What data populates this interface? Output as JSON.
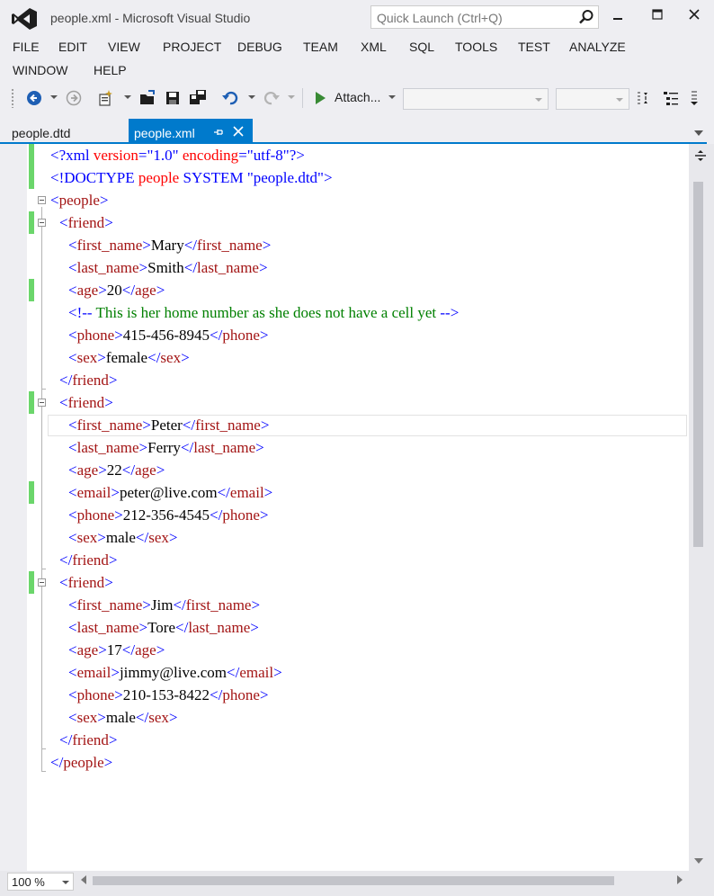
{
  "window": {
    "title": "people.xml - Microsoft Visual Studio",
    "quick_launch_placeholder": "Quick Launch (Ctrl+Q)"
  },
  "menu": [
    {
      "label": "FILE"
    },
    {
      "label": "EDIT"
    },
    {
      "label": "VIEW"
    },
    {
      "label": "PROJECT"
    },
    {
      "label": "DEBUG"
    },
    {
      "label": "TEAM"
    },
    {
      "label": "XML"
    },
    {
      "label": "SQL"
    },
    {
      "label": "TOOLS"
    },
    {
      "label": "TEST"
    },
    {
      "label": "ANALYZE"
    },
    {
      "label": "WINDOW"
    },
    {
      "label": "HELP"
    }
  ],
  "toolbar": {
    "attach_label": "Attach...",
    "icons": [
      "back-icon",
      "forward-icon",
      "new-project-icon",
      "open-file-icon",
      "save-icon",
      "save-all-icon",
      "undo-icon",
      "redo-icon",
      "start-icon"
    ]
  },
  "tabs": {
    "inactive": "people.dtd",
    "active": "people.xml"
  },
  "editor": {
    "lines": [
      [
        "<?xml ",
        "version",
        "=\"1.0\" ",
        "encoding",
        "=\"utf-8\"?>"
      ],
      [
        "<!DOCTYPE ",
        "people",
        " SYSTEM ",
        "\"people.dtd\"",
        ">"
      ],
      [
        "<",
        "people",
        ">"
      ],
      [
        "<",
        "friend",
        ">"
      ],
      [
        "<",
        "first_name",
        ">",
        "Mary",
        "</",
        "first_name",
        ">"
      ],
      [
        "<",
        "last_name",
        ">",
        "Smith",
        "</",
        "last_name",
        ">"
      ],
      [
        "<",
        "age",
        ">",
        "20",
        "</",
        "age",
        ">"
      ],
      [
        "<!--",
        " This is her home number as she does not have a cell yet ",
        "-->"
      ],
      [
        "<",
        "phone",
        ">",
        "415-456-8945",
        "</",
        "phone",
        ">"
      ],
      [
        "<",
        "sex",
        ">",
        "female",
        "</",
        "sex",
        ">"
      ],
      [
        "</",
        "friend",
        ">"
      ],
      [
        "<",
        "friend",
        ">"
      ],
      [
        "<",
        "first_name",
        ">",
        "Peter",
        "</",
        "first_name",
        ">"
      ],
      [
        "<",
        "last_name",
        ">",
        "Ferry",
        "</",
        "last_name",
        ">"
      ],
      [
        "<",
        "age",
        ">",
        "22",
        "</",
        "age",
        ">"
      ],
      [
        "<",
        "email",
        ">",
        "peter@live.com",
        "</",
        "email",
        ">"
      ],
      [
        "<",
        "phone",
        ">",
        "212-356-4545",
        "</",
        "phone",
        ">"
      ],
      [
        "<",
        "sex",
        ">",
        "male",
        "</",
        "sex",
        ">"
      ],
      [
        "</",
        "friend",
        ">"
      ],
      [
        "<",
        "friend",
        ">"
      ],
      [
        "<",
        "first_name",
        ">",
        "Jim",
        "</",
        "first_name",
        ">"
      ],
      [
        "<",
        "last_name",
        ">",
        "Tore",
        "</",
        "last_name",
        ">"
      ],
      [
        "<",
        "age",
        ">",
        "17",
        "</",
        "age",
        ">"
      ],
      [
        "<",
        "email",
        ">",
        "jimmy@live.com",
        "</",
        "email",
        ">"
      ],
      [
        "<",
        "phone",
        ">",
        "210-153-8422",
        "</",
        "phone",
        ">"
      ],
      [
        "<",
        "sex",
        ">",
        "male",
        "</",
        "sex",
        ">"
      ],
      [
        "</",
        "friend",
        ">"
      ],
      [
        "</",
        "people",
        ">"
      ]
    ]
  },
  "status": {
    "zoom": "100 %"
  },
  "colors": {
    "accent": "#007acc",
    "xml_delimiter": "#0000ff",
    "xml_name": "#a31515",
    "xml_attribute": "#ff0000",
    "xml_comment": "#008000",
    "change_bar": "#6bd66b"
  }
}
